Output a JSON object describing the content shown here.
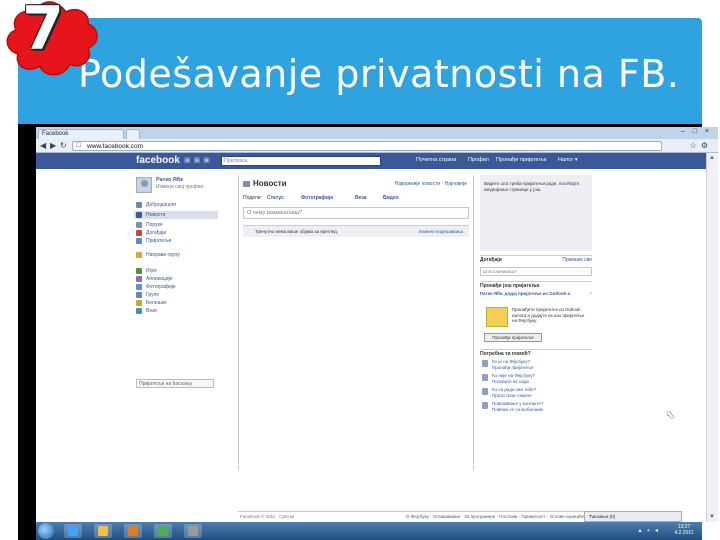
{
  "slide": {
    "badge_number": "7",
    "title": "Podešavanje privatnosti na FB.",
    "badge_color": "#e8141b",
    "title_bar_color": "#2ea3e0"
  },
  "browser": {
    "tab_label": "Facebook",
    "url": "www.facebook.com",
    "win_controls": "– □ ×"
  },
  "fb": {
    "logo": "facebook",
    "search_placeholder": "Претрага",
    "nav": [
      "Почетна страна",
      "Профил",
      "Пронађи пријатеље",
      "Налог ▾"
    ],
    "user_name": "Ратко Ябк",
    "user_edit": "Измени свој профил",
    "sidebar": [
      {
        "label": "Добродошли",
        "color": "#6d84b4"
      },
      {
        "label": "Новости",
        "color": "#3b5998"
      },
      {
        "label": "Поруке",
        "color": "#7b8fb6"
      },
      {
        "label": "Догађаји",
        "color": "#c24a3a"
      },
      {
        "label": "Пријатељи",
        "color": "#6d84b4"
      },
      {
        "label": "Направи групу",
        "color": "#e3a33b"
      },
      {
        "label": "Игре",
        "color": "#5a8f3c"
      },
      {
        "label": "Апликације",
        "color": "#8c6bb3"
      },
      {
        "label": "Фотографије",
        "color": "#5a8fd1"
      },
      {
        "label": "Групе",
        "color": "#6d84b4"
      },
      {
        "label": "Белешке",
        "color": "#c9a834"
      },
      {
        "label": "Везе",
        "color": "#4a8fb3"
      }
    ],
    "chat_search": "Пријатељи на ћаскању",
    "news_title": "Новости",
    "news_sort": "Најважније новости · Најновије",
    "share": [
      "Подели:",
      "Статус",
      "Фотографија",
      "Веза",
      "Видео"
    ],
    "share_placeholder": "О чему размишљаш?",
    "news_empty": "Тренутно нема више објава за преглед.",
    "news_empty_link": "Измени подешавања",
    "right_box_text": "Видите шта треба пријатељи раде, посећајте ажурирање странице у још.",
    "events_title": "Догађаји",
    "events_link": "Прикажи све",
    "event_placeholder": "Шта планираш?",
    "find_friends_title": "Пронађи још пријатеља",
    "friend_name": "Ратко Ябк, додај пријатеље из Outlook-a",
    "friend_desc": "Пронађите пријатеље из Outlook налога и додајте их као пријатеље на Фејсбуку.",
    "friend_button": "Пронађи пријатеље",
    "help_title": "Потребна ти помоћ?",
    "help": [
      {
        "q": "Ко је на Фејсбуку?",
        "a": "Пронађи пријатеље"
      },
      {
        "q": "Ко није на Фејсбуку?",
        "a": "Позовите их сада"
      },
      {
        "q": "Ко си ради сви тебе?",
        "a": "Прати свои гомиле"
      },
      {
        "q": "Повезивање у контакте?",
        "a": "Повежи се са мобилним"
      }
    ],
    "footer_left": "Facebook © 2011 · Српски",
    "footer_right": "О Фејсбуку · Оглашавање · За програмере · Послови · Приватност · Услови коришћења · Помоћ",
    "chat_bar": "Ћаскање (0)"
  },
  "taskbar": {
    "icons": [
      {
        "name": "ie-icon",
        "color": "#3fa4ff"
      },
      {
        "name": "explorer-icon",
        "color": "#f0c24a"
      },
      {
        "name": "media-icon",
        "color": "#e07b2a"
      },
      {
        "name": "chrome-icon",
        "color": "#4caf50"
      },
      {
        "name": "app-icon",
        "color": "#9b9b9b"
      }
    ],
    "time": "13:27",
    "date": "4.2.2011"
  }
}
